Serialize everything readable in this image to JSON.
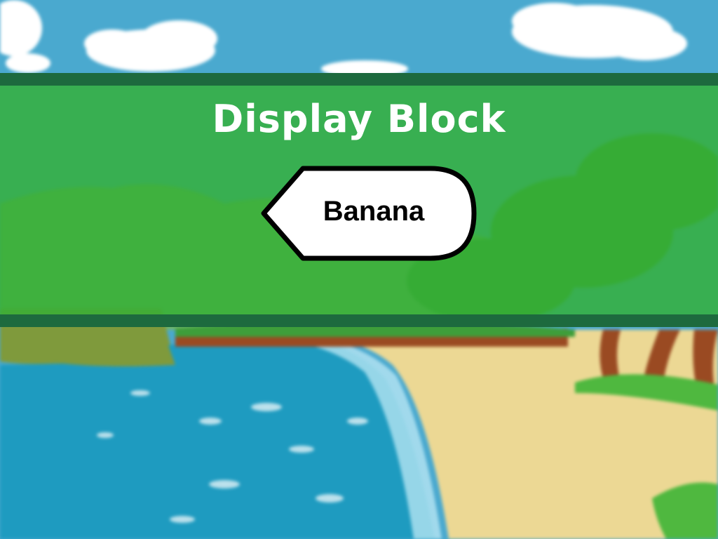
{
  "screen": {
    "title": "Display Block",
    "block_label": "Banana"
  },
  "background": {
    "scene": "tropical beach with sea, sand and palm trees",
    "icons": [
      "cloud-icon",
      "palm-tree-icon",
      "wave-icon"
    ]
  },
  "colors": {
    "banner_fill": "#34b034",
    "banner_border": "#1d6a3e",
    "title_text": "#ffffff",
    "block_fill": "#ffffff",
    "block_outline": "#000000",
    "sky": "#4aa9cf",
    "sea": "#1e9bc0",
    "sand": "#ecd894"
  }
}
